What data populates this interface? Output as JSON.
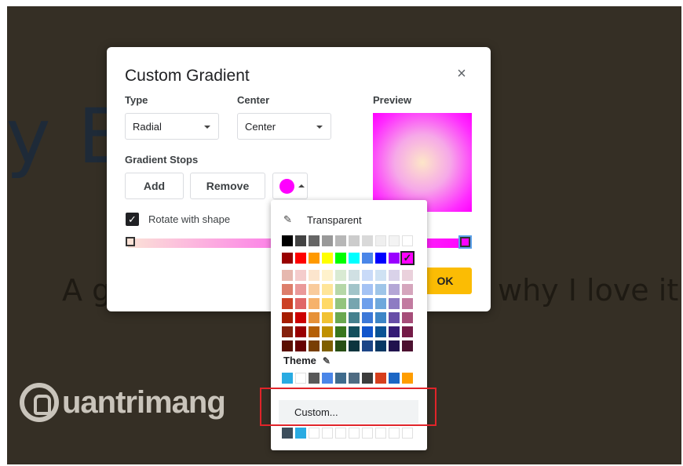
{
  "slide": {
    "title_text": "ly B              entati",
    "subtitle_left": "A g",
    "subtitle_right": "why I love it"
  },
  "watermark": {
    "text": "uantrimang"
  },
  "dialog": {
    "title": "Custom Gradient",
    "close_icon": "×",
    "type_label": "Type",
    "center_label": "Center",
    "preview_label": "Preview",
    "type_value": "Radial",
    "center_value": "Center",
    "stops_label": "Gradient Stops",
    "add_label": "Add",
    "remove_label": "Remove",
    "rotate_label": "Rotate with shape",
    "rotate_checked": "✓",
    "ok_label": "OK",
    "stop_color": "#ff00ff"
  },
  "palette": {
    "transparent_label": "Transparent",
    "transparent_icon": "✎",
    "theme_label": "Theme",
    "theme_edit_icon": "✎",
    "custom_label": "Custom...",
    "selected_check": "✓",
    "rows": [
      [
        "#000000",
        "#434343",
        "#666666",
        "#999999",
        "#b7b7b7",
        "#cccccc",
        "#d9d9d9",
        "#efefef",
        "#f3f3f3",
        "#ffffff"
      ],
      [
        "#980000",
        "#ff0000",
        "#ff9900",
        "#ffff00",
        "#00ff00",
        "#00ffff",
        "#4a86e8",
        "#0000ff",
        "#9900ff",
        "#ff00ff"
      ],
      [
        "#e6b8af",
        "#f4cccc",
        "#fce5cd",
        "#fff2cc",
        "#d9ead3",
        "#d0e0e3",
        "#c9daf8",
        "#cfe2f3",
        "#d9d2e9",
        "#ead1dc"
      ],
      [
        "#dd7e6b",
        "#ea9999",
        "#f9cb9c",
        "#ffe599",
        "#b6d7a8",
        "#a2c4c9",
        "#a4c2f4",
        "#9fc5e8",
        "#b4a7d6",
        "#d5a6bd"
      ],
      [
        "#cc4125",
        "#e06666",
        "#f6b26b",
        "#ffd966",
        "#93c47d",
        "#76a5af",
        "#6d9eeb",
        "#6fa8dc",
        "#8e7cc3",
        "#c27ba0"
      ],
      [
        "#a61c00",
        "#cc0000",
        "#e69138",
        "#f1c232",
        "#6aa84f",
        "#45818e",
        "#3c78d8",
        "#3d85c6",
        "#674ea7",
        "#a64d79"
      ],
      [
        "#85200c",
        "#990000",
        "#b45f06",
        "#bf9000",
        "#38761d",
        "#134f5c",
        "#1155cc",
        "#0b5394",
        "#351c75",
        "#741b47"
      ],
      [
        "#5b0f00",
        "#660000",
        "#783f04",
        "#7f6000",
        "#274e13",
        "#0c343d",
        "#1c4587",
        "#073763",
        "#20124d",
        "#4c1130"
      ]
    ],
    "theme_row": [
      "#29abe2",
      "#ffffff",
      "#595959",
      "#4a86e8",
      "#3f6b8c",
      "#4e6b82",
      "#3c3c3c",
      "#d63e1c",
      "#1c66c4",
      "#ff9d00"
    ],
    "recent_row": [
      "#3c4e5c",
      "#29abe2",
      "#ffffff",
      "#ffffff",
      "#ffffff",
      "#ffffff",
      "#ffffff",
      "#ffffff",
      "#ffffff",
      "#ffffff"
    ]
  }
}
